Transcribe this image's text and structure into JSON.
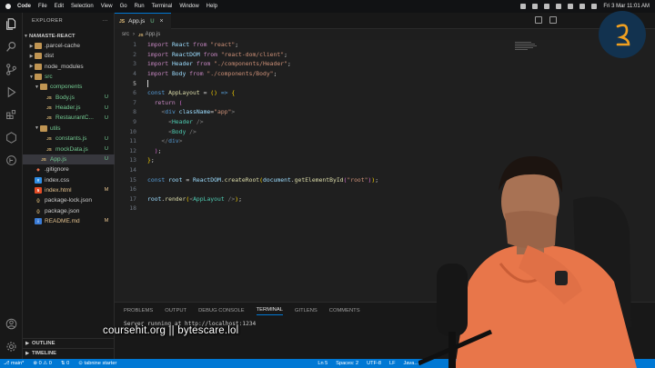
{
  "menubar": {
    "items": [
      "Code",
      "File",
      "Edit",
      "Selection",
      "View",
      "Go",
      "Run",
      "Terminal",
      "Window",
      "Help"
    ],
    "datetime": "Fri 3 Mar  11:01 AM"
  },
  "sidebar": {
    "title": "EXPLORER",
    "root": "NAMASTE-REACT",
    "tree": [
      {
        "name": ".parcel-cache",
        "depth": 1,
        "type": "folder",
        "open": false,
        "badge": "",
        "color": "#cccccc"
      },
      {
        "name": "dist",
        "depth": 1,
        "type": "folder",
        "open": false,
        "badge": "",
        "color": "#cccccc"
      },
      {
        "name": "node_modules",
        "depth": 1,
        "type": "folder",
        "open": false,
        "badge": "",
        "color": "#cccccc"
      },
      {
        "name": "src",
        "depth": 1,
        "type": "folder",
        "open": true,
        "badge": "",
        "color": "#73c991"
      },
      {
        "name": "components",
        "depth": 2,
        "type": "folder",
        "open": true,
        "badge": "",
        "color": "#73c991"
      },
      {
        "name": "Body.js",
        "depth": 3,
        "type": "js",
        "badge": "U",
        "color": "#73c991"
      },
      {
        "name": "Header.js",
        "depth": 3,
        "type": "js",
        "badge": "U",
        "color": "#73c991"
      },
      {
        "name": "RestaurantC...",
        "depth": 3,
        "type": "js",
        "badge": "U",
        "color": "#73c991"
      },
      {
        "name": "utils",
        "depth": 2,
        "type": "folder",
        "open": true,
        "badge": "",
        "color": "#73c991"
      },
      {
        "name": "constants.js",
        "depth": 3,
        "type": "js",
        "badge": "U",
        "color": "#73c991"
      },
      {
        "name": "mockData.js",
        "depth": 3,
        "type": "js",
        "badge": "U",
        "color": "#73c991"
      },
      {
        "name": "App.js",
        "depth": 2,
        "type": "js",
        "badge": "U",
        "color": "#73c991",
        "active": true
      },
      {
        "name": ".gitignore",
        "depth": 1,
        "type": "git",
        "badge": "",
        "color": "#cccccc"
      },
      {
        "name": "index.css",
        "depth": 1,
        "type": "css",
        "badge": "",
        "color": "#cccccc"
      },
      {
        "name": "index.html",
        "depth": 1,
        "type": "html",
        "badge": "M",
        "color": "#e2c08d"
      },
      {
        "name": "package-lock.json",
        "depth": 1,
        "type": "json",
        "badge": "",
        "color": "#cccccc"
      },
      {
        "name": "package.json",
        "depth": 1,
        "type": "json",
        "badge": "",
        "color": "#cccccc"
      },
      {
        "name": "README.md",
        "depth": 1,
        "type": "md",
        "badge": "M",
        "color": "#e2c08d"
      }
    ],
    "outline": "OUTLINE",
    "timeline": "TIMELINE"
  },
  "tab": {
    "icon": "JS",
    "label": "App.js",
    "status": "U"
  },
  "breadcrumb": {
    "folder": "src",
    "file": "App.js"
  },
  "editor": {
    "lines": [
      [
        {
          "t": "import ",
          "c": "kw"
        },
        {
          "t": "React",
          "c": "id"
        },
        {
          "t": " from ",
          "c": "kw"
        },
        {
          "t": "\"react\"",
          "c": "str"
        },
        {
          "t": ";",
          "c": "code"
        }
      ],
      [
        {
          "t": "import ",
          "c": "kw"
        },
        {
          "t": "ReactDOM",
          "c": "id"
        },
        {
          "t": " from ",
          "c": "kw"
        },
        {
          "t": "\"react-dom/client\"",
          "c": "str"
        },
        {
          "t": ";",
          "c": "code"
        }
      ],
      [
        {
          "t": "import ",
          "c": "kw"
        },
        {
          "t": "Header",
          "c": "id"
        },
        {
          "t": " from ",
          "c": "kw"
        },
        {
          "t": "\"./components/Header\"",
          "c": "str"
        },
        {
          "t": ";",
          "c": "code"
        }
      ],
      [
        {
          "t": "import ",
          "c": "kw"
        },
        {
          "t": "Body",
          "c": "id"
        },
        {
          "t": " from ",
          "c": "kw"
        },
        {
          "t": "\"./components/Body\"",
          "c": "str"
        },
        {
          "t": ";",
          "c": "code"
        }
      ],
      [],
      [
        {
          "t": "const ",
          "c": "kw2"
        },
        {
          "t": "AppLayout",
          "c": "fn"
        },
        {
          "t": " = ",
          "c": "code"
        },
        {
          "t": "()",
          "c": "br1"
        },
        {
          "t": " => ",
          "c": "kw2"
        },
        {
          "t": "{",
          "c": "br1"
        }
      ],
      [
        {
          "t": "  return ",
          "c": "kw"
        },
        {
          "t": "(",
          "c": "br2"
        }
      ],
      [
        {
          "t": "    <",
          "c": "pun"
        },
        {
          "t": "div",
          "c": "kw2"
        },
        {
          "t": " className",
          "c": "attr"
        },
        {
          "t": "=",
          "c": "code"
        },
        {
          "t": "\"app\"",
          "c": "str"
        },
        {
          "t": ">",
          "c": "pun"
        }
      ],
      [
        {
          "t": "      <",
          "c": "pun"
        },
        {
          "t": "Header",
          "c": "tag"
        },
        {
          "t": " />",
          "c": "pun"
        }
      ],
      [
        {
          "t": "      <",
          "c": "pun"
        },
        {
          "t": "Body",
          "c": "tag"
        },
        {
          "t": " />",
          "c": "pun"
        }
      ],
      [
        {
          "t": "    </",
          "c": "pun"
        },
        {
          "t": "div",
          "c": "kw2"
        },
        {
          "t": ">",
          "c": "pun"
        }
      ],
      [
        {
          "t": "  )",
          "c": "br2"
        },
        {
          "t": ";",
          "c": "code"
        }
      ],
      [
        {
          "t": "}",
          "c": "br1"
        },
        {
          "t": ";",
          "c": "code"
        }
      ],
      [],
      [
        {
          "t": "const ",
          "c": "kw2"
        },
        {
          "t": "root",
          "c": "id"
        },
        {
          "t": " = ",
          "c": "code"
        },
        {
          "t": "ReactDOM",
          "c": "id"
        },
        {
          "t": ".",
          "c": "code"
        },
        {
          "t": "createRoot",
          "c": "fn"
        },
        {
          "t": "(",
          "c": "br1"
        },
        {
          "t": "document",
          "c": "id"
        },
        {
          "t": ".",
          "c": "code"
        },
        {
          "t": "getElementById",
          "c": "fn"
        },
        {
          "t": "(",
          "c": "br2"
        },
        {
          "t": "\"root\"",
          "c": "str"
        },
        {
          "t": ")",
          "c": "br2"
        },
        {
          "t": ")",
          "c": "br1"
        },
        {
          "t": ";",
          "c": "code"
        }
      ],
      [],
      [
        {
          "t": "root",
          "c": "id"
        },
        {
          "t": ".",
          "c": "code"
        },
        {
          "t": "render",
          "c": "fn"
        },
        {
          "t": "(",
          "c": "br1"
        },
        {
          "t": "<",
          "c": "pun"
        },
        {
          "t": "AppLayout",
          "c": "tag"
        },
        {
          "t": " />",
          "c": "pun"
        },
        {
          "t": ")",
          "c": "br1"
        },
        {
          "t": ";",
          "c": "code"
        }
      ],
      []
    ],
    "active_line": 5
  },
  "panel": {
    "tabs": [
      "PROBLEMS",
      "OUTPUT",
      "DEBUG CONSOLE",
      "TERMINAL",
      "GITLENS",
      "COMMENTS"
    ],
    "active_tab": "TERMINAL",
    "terminal_line": "Server running at http://localhost:1234"
  },
  "statusbar": {
    "branch": "main*",
    "errors": "⊗ 0 ⚠ 0",
    "remote": "0",
    "tabnine": "tabnine starter",
    "position": "Ln 5",
    "spaces": "Spaces: 2",
    "encoding": "UTF-8",
    "eol": "LF",
    "lang": "Java..."
  },
  "watermark": "coursehit.org || bytescare.lol",
  "colors": {
    "accent": "#0078d4",
    "untracked": "#73c991",
    "modified": "#e2c08d"
  }
}
